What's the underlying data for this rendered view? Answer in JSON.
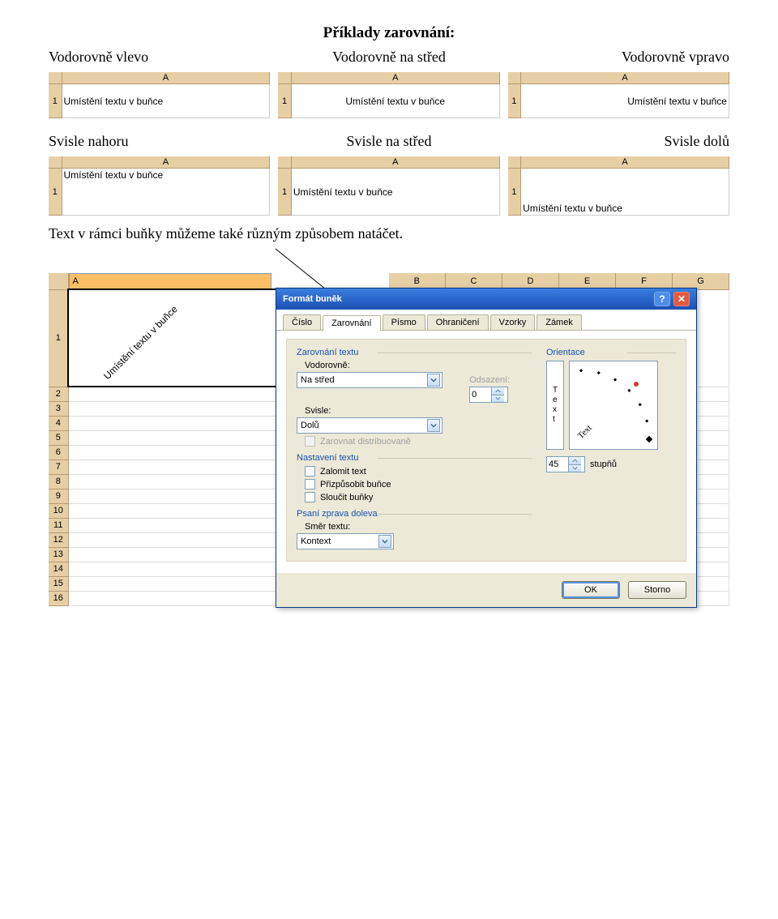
{
  "title": "Příklady zarovnání:",
  "captions": {
    "h1": "Vodorovně vlevo",
    "h2": "Vodorovně na střed",
    "h3": "Vodorovně vpravo",
    "v1": "Svisle nahoru",
    "v2": "Svisle na střed",
    "v3": "Svisle dolů"
  },
  "mini": {
    "col": "A",
    "row": "1",
    "cell_text": "Umístění textu v buňce"
  },
  "body_text": "Text v rámci buňky můžeme také různým způsobem natáčet.",
  "sheet": {
    "cols": [
      "A",
      "B",
      "C",
      "D",
      "E",
      "F",
      "G"
    ],
    "rows": [
      "1",
      "2",
      "3",
      "4",
      "5",
      "6",
      "7",
      "8",
      "9",
      "10",
      "11",
      "12",
      "13",
      "14",
      "15",
      "16"
    ],
    "a1_text": "Umístění textu v buňce"
  },
  "dialog": {
    "title": "Formát buněk",
    "tabs": [
      "Číslo",
      "Zarovnání",
      "Písmo",
      "Ohraničení",
      "Vzorky",
      "Zámek"
    ],
    "active_tab": 1,
    "groups": {
      "align": "Zarovnání textu",
      "text_settings": "Nastavení textu",
      "rtl": "Psaní zprava doleva",
      "orient": "Orientace"
    },
    "labels": {
      "vodorovne": "Vodorovně:",
      "svisle": "Svisle:",
      "odsazeni": "Odsazení:",
      "smer": "Směr textu:",
      "stupnu": "stupňů"
    },
    "values": {
      "vodorovne": "Na střed",
      "svisle": "Dolů",
      "odsazeni": "0",
      "smer": "Kontext",
      "stupne": "45"
    },
    "checkboxes": {
      "distrib": "Zarovnat distribuovaně",
      "zalomit": "Zalomit text",
      "prizpusobit": "Přizpůsobit buňce",
      "sloucit": "Sloučit buňky"
    },
    "orient_vert": "Text",
    "orient_dial": "Text",
    "buttons": {
      "ok": "OK",
      "storno": "Storno"
    }
  }
}
